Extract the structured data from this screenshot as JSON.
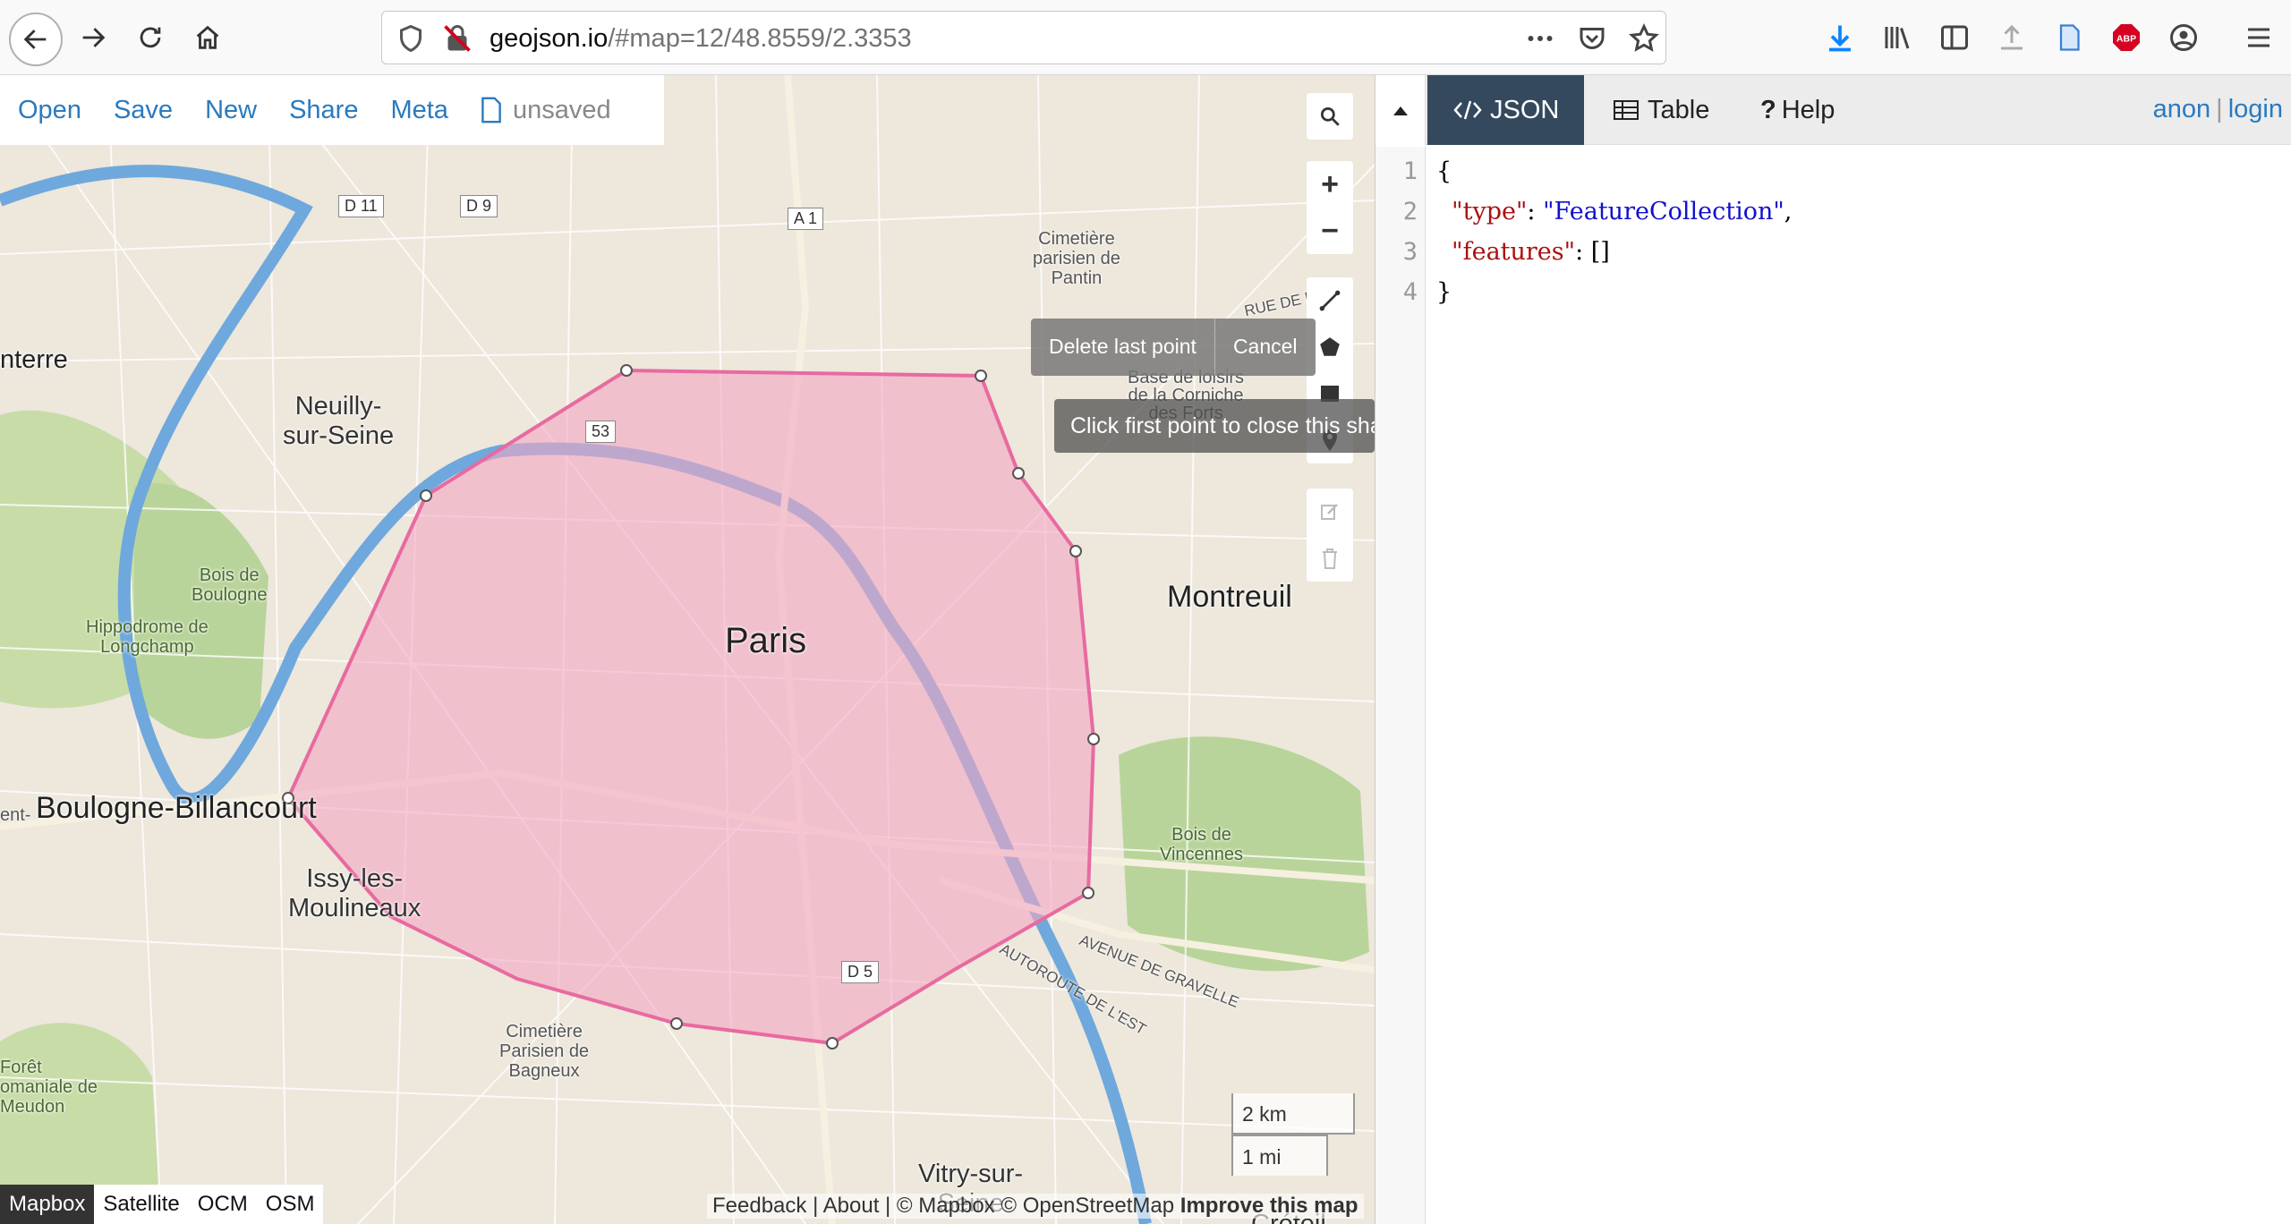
{
  "browser": {
    "url_host": "geojson.io",
    "url_rest": "/#map=12/48.8559/2.3353"
  },
  "map_menu": {
    "open": "Open",
    "save": "Save",
    "new": "New",
    "share": "Share",
    "meta": "Meta",
    "status": "unsaved"
  },
  "draw_tooltip": {
    "delete_last_point": "Delete last point",
    "cancel": "Cancel",
    "hint": "Click first point to close this shape"
  },
  "map_labels": {
    "paris": "Paris",
    "montreuil": "Montreuil",
    "boulogne": "Boulogne-Billancourt",
    "nanterre": "nterre",
    "neuilly": "Neuilly-\nsur-Seine",
    "issy": "Issy-les-\nMoulineaux",
    "bois_boulogne": "Bois de\nBoulogne",
    "hippodrome": "Hippodrome de\nLongchamp",
    "bois_vincennes": "Bois de\nVincennes",
    "cimetiere_pantin": "Cimetière\nparisien de\nPantin",
    "cimetiere_bagneux": "Cimetière\nParisien de\nBagneux",
    "base_loisirs": "Base de loisirs\nde la Corniche\ndes Forts",
    "foret": "Forêt\nomaniale de\nMeudon",
    "vitry": "Vitry-sur-\nSeine",
    "ent": "ent-",
    "avenue_gravelle": "AVENUE DE GRAVELLE",
    "autoroute_est": "AUTOROUTE DE L'EST",
    "rue_de": "RUE DE P",
    "creteil": "Créteil",
    "shields": [
      "D 11",
      "D 9",
      "A 1",
      "53",
      "D 5"
    ]
  },
  "scale": {
    "km": "2 km",
    "mi": "1 mi"
  },
  "layers": [
    "Mapbox",
    "Satellite",
    "OCM",
    "OSM"
  ],
  "active_layer": "Mapbox",
  "attribution": {
    "text": "Feedback | About | © Mapbox © OpenStreetMap",
    "improve": "Improve this map"
  },
  "pane": {
    "tabs": [
      "JSON",
      "Table",
      "Help"
    ],
    "active_tab": "JSON",
    "user": "anon",
    "login": "login",
    "line_numbers": [
      "1",
      "2",
      "3",
      "4"
    ],
    "code": {
      "open_brace": "{",
      "type_key": "\"type\"",
      "type_value": "\"FeatureCollection\"",
      "features_key": "\"features\"",
      "features_value": "[]",
      "close_brace": "}"
    }
  },
  "colors": {
    "accent": "#2a7abf",
    "json_tab": "#34495e",
    "polygon_fill": "#f4a6c3",
    "polygon_stroke": "#e86aa0"
  }
}
